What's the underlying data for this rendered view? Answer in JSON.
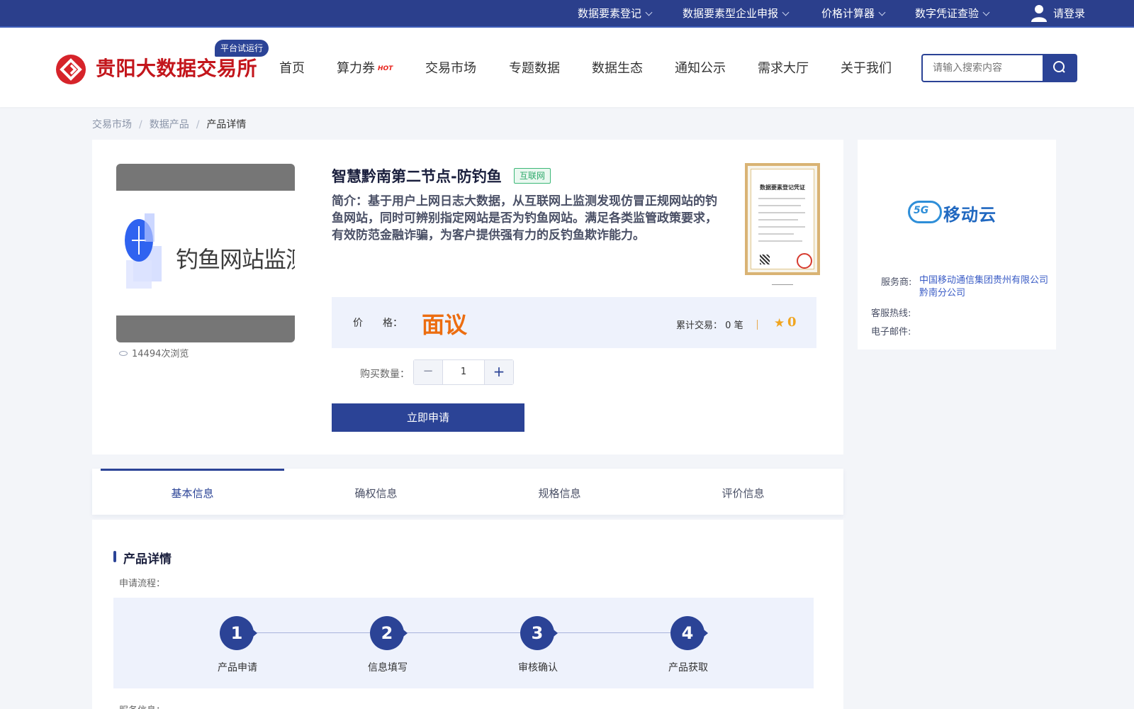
{
  "topbar": {
    "items": [
      {
        "label": "数据要素登记"
      },
      {
        "label": "数据要素型企业申报"
      },
      {
        "label": "价格计算器"
      },
      {
        "label": "数字凭证查验"
      }
    ],
    "login_label": "请登录"
  },
  "header": {
    "brand": "贵阳大数据交易所",
    "beta_badge": "平台试运行",
    "nav": [
      {
        "label": "首页"
      },
      {
        "label": "算力券"
      },
      {
        "label": "交易市场"
      },
      {
        "label": "专题数据"
      },
      {
        "label": "数据生态"
      },
      {
        "label": "通知公示"
      },
      {
        "label": "需求大厅"
      },
      {
        "label": "关于我们"
      }
    ],
    "hot_badge": "HOT",
    "search": {
      "placeholder": "请输入搜索内容"
    }
  },
  "breadcrumb": {
    "items": [
      "交易市场",
      "数据产品"
    ],
    "current": "产品详情",
    "separator": "/"
  },
  "product": {
    "image_text": "钓鱼网站监测",
    "views": "14494次浏览",
    "title": "智慧黔南第二节点-防钓鱼",
    "tag": "互联网",
    "description": "简介：基于用户上网日志大数据，从互联网上监测发现仿冒正规网站的钓鱼网站，同时可辨别指定网站是否为钓鱼网站。满足各类监管政策要求，有效防范金融诈骗，为客户提供强有力的反钓鱼欺诈能力。",
    "certificate_title": "数据要素登记凭证",
    "price_label": "价　　格：",
    "price_value": "面议",
    "trade_label": "累计交易：",
    "trade_count": "0",
    "trade_unit": "笔",
    "rating": "0",
    "qty_label": "购买数量：",
    "qty_value": "1",
    "apply_button": "立即申请"
  },
  "provider": {
    "logo_text": "移动云",
    "logo_mark": "5G",
    "service_label": "服务商:",
    "service_value": "中国移动通信集团贵州有限公司黔南分公司",
    "hotline_label": "客服热线:",
    "email_label": "电子邮件:"
  },
  "tabs": [
    {
      "label": "基本信息"
    },
    {
      "label": "确权信息"
    },
    {
      "label": "规格信息"
    },
    {
      "label": "评价信息"
    }
  ],
  "detail": {
    "section_title": "产品详情",
    "flow_label": "申请流程：",
    "steps": [
      {
        "num": "1",
        "label": "产品申请"
      },
      {
        "num": "2",
        "label": "信息填写"
      },
      {
        "num": "3",
        "label": "审核确认"
      },
      {
        "num": "4",
        "label": "产品获取"
      }
    ],
    "service_info_label": "服务信息："
  },
  "colors": {
    "primary": "#2b4396",
    "brand_red": "#c3161c",
    "price_orange": "#ec6d10",
    "tag_green": "#2ea96b",
    "star": "#f0a520"
  }
}
